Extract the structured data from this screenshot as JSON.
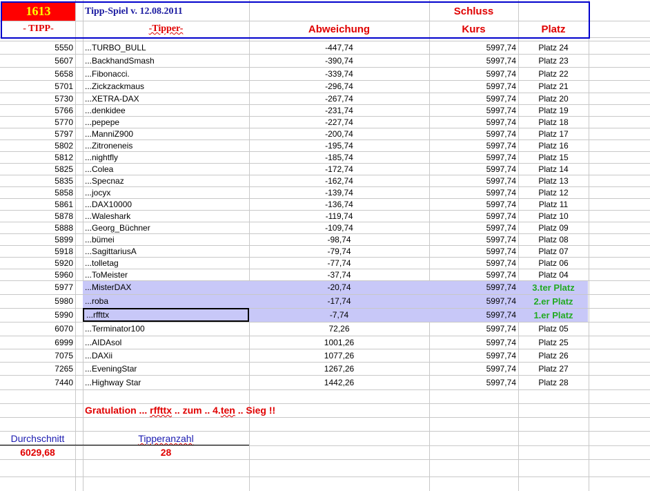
{
  "header": {
    "number": "1613",
    "title": "Tipp-Spiel v. 12.08.2011",
    "schluss": "Schluss",
    "col_tipp": "- TIPP-",
    "col_tipper": "-Tipper-",
    "col_abweichung": "Abweichung",
    "col_kurs": "Kurs",
    "col_platz": "Platz"
  },
  "colors": {
    "accent_red": "#e00000",
    "border_blue": "#0000cc",
    "highlight": "#c8c8f8",
    "green": "#22aa22",
    "number_yellow": "#ffff00"
  },
  "rows": [
    {
      "tipp": "5550",
      "tipper": "...TURBO_BULL",
      "abw": "-447,74",
      "kurs": "5997,74",
      "platz": "Platz 24"
    },
    {
      "tipp": "5607",
      "tipper": "...BackhandSmash",
      "abw": "-390,74",
      "kurs": "5997,74",
      "platz": "Platz 23"
    },
    {
      "tipp": "5658",
      "tipper": "...Fibonacci.",
      "abw": "-339,74",
      "kurs": "5997,74",
      "platz": "Platz 22"
    },
    {
      "tipp": "5701",
      "tipper": "...Zickzackmaus",
      "abw": "-296,74",
      "kurs": "5997,74",
      "platz": "Platz 21"
    },
    {
      "tipp": "5730",
      "tipper": "...XETRA-DAX",
      "abw": "-267,74",
      "kurs": "5997,74",
      "platz": "Platz 20"
    },
    {
      "tipp": "5766",
      "tipper": "...denkidee",
      "abw": "-231,74",
      "kurs": "5997,74",
      "platz": "Platz 19"
    },
    {
      "tipp": "5770",
      "tipper": "...pepepe",
      "abw": "-227,74",
      "kurs": "5997,74",
      "platz": "Platz 18"
    },
    {
      "tipp": "5797",
      "tipper": "...ManniZ900",
      "abw": "-200,74",
      "kurs": "5997,74",
      "platz": "Platz 17"
    },
    {
      "tipp": "5802",
      "tipper": "...Zitroneneis",
      "abw": "-195,74",
      "kurs": "5997,74",
      "platz": "Platz 16"
    },
    {
      "tipp": "5812",
      "tipper": "...nightfly",
      "abw": "-185,74",
      "kurs": "5997,74",
      "platz": "Platz 15"
    },
    {
      "tipp": "5825",
      "tipper": "...Colea",
      "abw": "-172,74",
      "kurs": "5997,74",
      "platz": "Platz 14"
    },
    {
      "tipp": "5835",
      "tipper": "...Specnaz",
      "abw": "-162,74",
      "kurs": "5997,74",
      "platz": "Platz 13"
    },
    {
      "tipp": "5858",
      "tipper": "...jocyx",
      "abw": "-139,74",
      "kurs": "5997,74",
      "platz": "Platz 12"
    },
    {
      "tipp": "5861",
      "tipper": "...DAX10000",
      "abw": "-136,74",
      "kurs": "5997,74",
      "platz": "Platz 11"
    },
    {
      "tipp": "5878",
      "tipper": "...Waleshark",
      "abw": "-119,74",
      "kurs": "5997,74",
      "platz": "Platz 10"
    },
    {
      "tipp": "5888",
      "tipper": "...Georg_Büchner",
      "abw": "-109,74",
      "kurs": "5997,74",
      "platz": "Platz 09"
    },
    {
      "tipp": "5899",
      "tipper": "...bümei",
      "abw": "-98,74",
      "kurs": "5997,74",
      "platz": "Platz 08"
    },
    {
      "tipp": "5918",
      "tipper": "...SagittariusA",
      "abw": "-79,74",
      "kurs": "5997,74",
      "platz": "Platz 07"
    },
    {
      "tipp": "5920",
      "tipper": "...tolletag",
      "abw": "-77,74",
      "kurs": "5997,74",
      "platz": "Platz 06"
    },
    {
      "tipp": "5960",
      "tipper": "...ToMeister",
      "abw": "-37,74",
      "kurs": "5997,74",
      "platz": "Platz 04"
    },
    {
      "tipp": "5977",
      "tipper": "...MisterDAX",
      "abw": "-20,74",
      "kurs": "5997,74",
      "platz": "3.ter Platz",
      "winner": true
    },
    {
      "tipp": "5980",
      "tipper": "...roba",
      "abw": "-17,74",
      "kurs": "5997,74",
      "platz": "2.er Platz",
      "winner": true
    },
    {
      "tipp": "5990",
      "tipper": "...rffttx",
      "abw": "-7,74",
      "kurs": "5997,74",
      "platz": "1.er Platz",
      "winner": true,
      "selected": true
    },
    {
      "tipp": "6070",
      "tipper": "...Terminator100",
      "abw": "72,26",
      "kurs": "5997,74",
      "platz": "Platz 05"
    },
    {
      "tipp": "6999",
      "tipper": "...AIDAsol",
      "abw": "1001,26",
      "kurs": "5997,74",
      "platz": "Platz 25"
    },
    {
      "tipp": "7075",
      "tipper": "...DAXii",
      "abw": "1077,26",
      "kurs": "5997,74",
      "platz": "Platz 26"
    },
    {
      "tipp": "7265",
      "tipper": "...EveningStar",
      "abw": "1267,26",
      "kurs": "5997,74",
      "platz": "Platz 27"
    },
    {
      "tipp": "7440",
      "tipper": "...Highway Star",
      "abw": "1442,26",
      "kurs": "5997,74",
      "platz": "Platz 28"
    }
  ],
  "footer": {
    "g1": "Gratulation ... ",
    "g2": "rffttx",
    "g3": " .. zum .. 4.",
    "g4": "ten",
    "g5": " .. Sieg !!",
    "durchschnitt_label": "Durchschnitt",
    "durchschnitt_value": "6029,68",
    "tipperanzahl_label": "Tipperanzahl",
    "tipperanzahl_value": "28"
  }
}
